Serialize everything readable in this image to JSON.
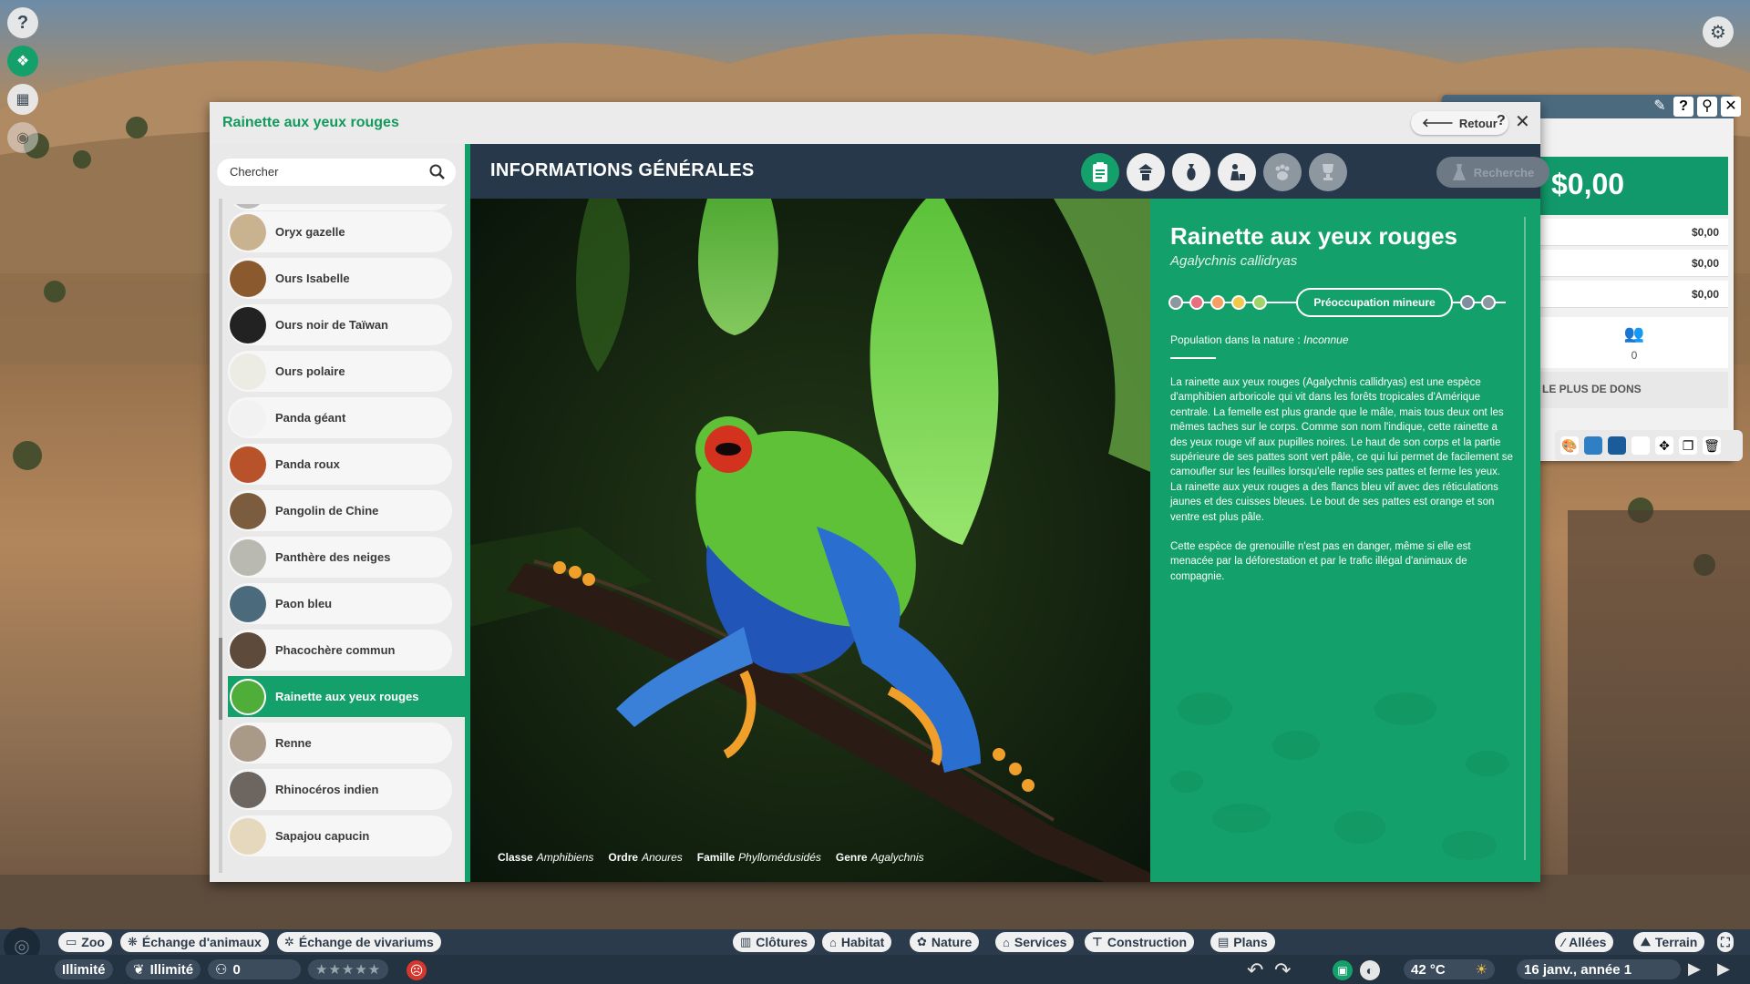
{
  "dialog": {
    "title": "Rainette aux yeux rouges",
    "back_label": "Retour",
    "help_label": "?",
    "close_label": "✕"
  },
  "search": {
    "placeholder": "Chercher"
  },
  "species_list": [
    {
      "label": "Oryx gazelle",
      "color": "#c9b28f"
    },
    {
      "label": "Ours Isabelle",
      "color": "#8a5a2e"
    },
    {
      "label": "Ours noir de Taïwan",
      "color": "#222222"
    },
    {
      "label": "Ours polaire",
      "color": "#ecebe4"
    },
    {
      "label": "Panda géant",
      "color": "#f2f2f2"
    },
    {
      "label": "Panda roux",
      "color": "#b8522a"
    },
    {
      "label": "Pangolin de Chine",
      "color": "#7b5c3e"
    },
    {
      "label": "Panthère des neiges",
      "color": "#b9b9b2"
    },
    {
      "label": "Paon bleu",
      "color": "#4b6a7b"
    },
    {
      "label": "Phacochère commun",
      "color": "#5e4a3a"
    },
    {
      "label": "Rainette aux yeux rouges",
      "color": "#4fae3a",
      "active": true
    },
    {
      "label": "Renne",
      "color": "#a89a86"
    },
    {
      "label": "Rhinocéros indien",
      "color": "#6c6560"
    },
    {
      "label": "Sapajou capucin",
      "color": "#e6d8bd"
    }
  ],
  "section": {
    "title": "INFORMATIONS GÉNÉRALES",
    "tabs": [
      "clipboard-icon",
      "habitat-icon",
      "food-icon",
      "enrichment-icon",
      "paw-icon",
      "trophy-icon"
    ],
    "research_label": "Recherche"
  },
  "taxonomy": [
    {
      "key": "Classe",
      "value": "Amphibiens"
    },
    {
      "key": "Ordre",
      "value": "Anoures"
    },
    {
      "key": "Famille",
      "value": "Phyllomédusidés"
    },
    {
      "key": "Genre",
      "value": "Agalychnis"
    }
  ],
  "info": {
    "name": "Rainette aux yeux rouges",
    "scientific": "Agalychnis callidryas",
    "conservation_label": "Préoccupation mineure",
    "conservation_dots_left": [
      "#8d97a0",
      "#e76f7e",
      "#f4a062",
      "#f2c94c",
      "#9fd46a"
    ],
    "conservation_dots_right": [
      "#7d8f9e",
      "#8d97a0"
    ],
    "population_label": "Population dans la nature :",
    "population_value": "Inconnue",
    "description_1": "La rainette aux yeux rouges (Agalychnis callidryas) est une espèce d'amphibien arboricole qui vit dans les forêts tropicales d'Amérique centrale. La femelle est plus grande que le mâle, mais tous deux ont les mêmes taches sur le corps. Comme son nom l'indique, cette rainette a des yeux rouge vif aux pupilles noires. Le haut de son corps et la partie supérieure de ses pattes sont vert pâle, ce qui lui permet de facilement se camoufler sur les feuilles lorsqu'elle replie ses pattes et ferme les yeux. La rainette aux yeux rouges a des flancs bleu vif avec des réticulations jaunes et des cuisses bleues. Le bout de ses pattes est orange et son ventre est plus pâle.",
    "description_2": "Cette espèce de grenouille n'est pas en danger, même si elle est menacée par la déforestation et par le trafic illégal d'animaux de compagnie."
  },
  "side_panel": {
    "balance": "$0,00",
    "rows": [
      "$0,00",
      "$0,00",
      "$0,00"
    ],
    "donor_count": "0",
    "most_donations_label": "LE PLUS DE DONS"
  },
  "toolbar": {
    "left": [
      {
        "label": "Zoo",
        "icon": "zoo-icon"
      },
      {
        "label": "Échange d'animaux",
        "icon": "paw-icon"
      },
      {
        "label": "Échange de vivariums",
        "icon": "bug-icon"
      }
    ],
    "center": [
      {
        "label": "Clôtures",
        "icon": "fence-icon"
      },
      {
        "label": "Habitat",
        "icon": "habitat-icon"
      },
      {
        "label": "Nature",
        "icon": "nature-icon"
      },
      {
        "label": "Services",
        "icon": "services-icon"
      },
      {
        "label": "Construction",
        "icon": "construction-icon"
      },
      {
        "label": "Plans",
        "icon": "plans-icon"
      }
    ],
    "right": [
      {
        "label": "Allées",
        "icon": "path-icon"
      },
      {
        "label": "Terrain",
        "icon": "terrain-icon"
      }
    ]
  },
  "status": {
    "money_mode": "Illimité",
    "research_mode": "Illimité",
    "guests": "0",
    "temperature": "42 °C",
    "date": "16 janv., année 1"
  }
}
